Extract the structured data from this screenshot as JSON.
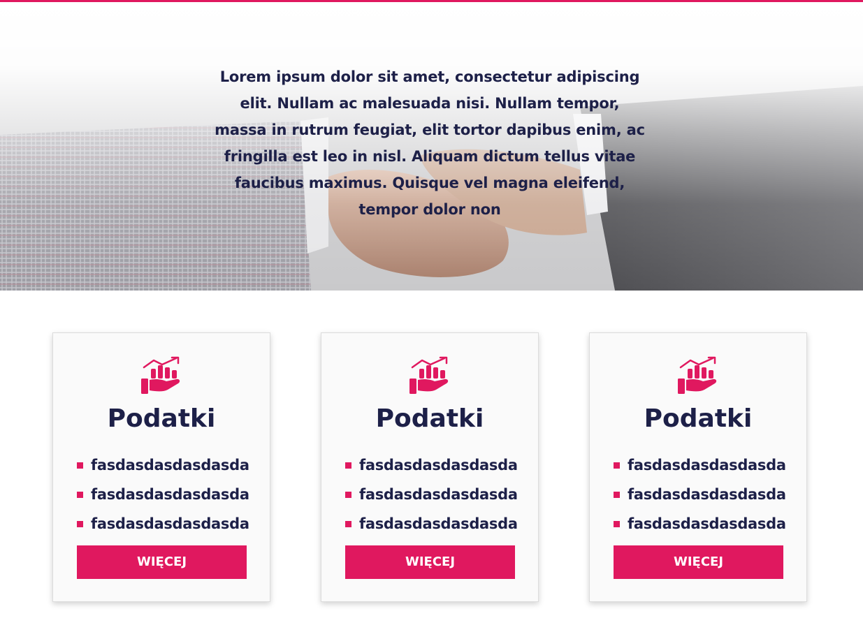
{
  "hero": {
    "text": "Lorem ipsum dolor sit amet, consectetur adipiscing elit. Nullam ac malesuada nisi. Nullam tempor, massa in rutrum feugiat, elit tortor dapibus enim, ac fringilla est leo in nisl. Aliquam dictum tellus vitae faucibus maximus. Quisque vel magna eleifend, tempor dolor non",
    "image": "handshake-photo"
  },
  "colors": {
    "accent": "#e0185f",
    "text": "#1d2048"
  },
  "cards": [
    {
      "icon": "growth-chart-hand-icon",
      "title": "Podatki",
      "items": [
        "fasdasdasdasdasda",
        "fasdasdasdasdasda",
        "fasdasdasdasdasda"
      ],
      "button": "WIĘCEJ"
    },
    {
      "icon": "growth-chart-hand-icon",
      "title": "Podatki",
      "items": [
        "fasdasdasdasdasda",
        "fasdasdasdasdasda",
        "fasdasdasdasdasda"
      ],
      "button": "WIĘCEJ"
    },
    {
      "icon": "growth-chart-hand-icon",
      "title": "Podatki",
      "items": [
        "fasdasdasdasdasda",
        "fasdasdasdasdasda",
        "fasdasdasdasdasda"
      ],
      "button": "WIĘCEJ"
    }
  ]
}
